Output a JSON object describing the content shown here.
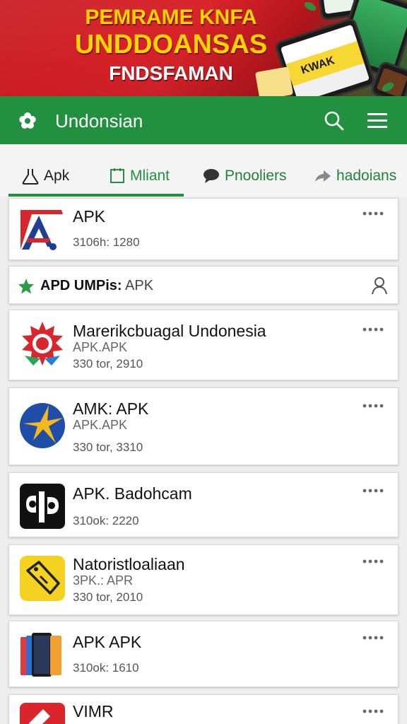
{
  "banner": {
    "line1": "PEMRAME KNFA",
    "line2": "UNDDOANSAS",
    "line3": "FNDSFAMAN",
    "phone_text": "KWAK"
  },
  "toolbar": {
    "title": "Undonsian",
    "logo_icon": "flower-icon",
    "search_icon": "search-icon",
    "menu_icon": "hamburger-menu-icon",
    "color": "#219140"
  },
  "tabs": [
    {
      "label": "Apk",
      "icon": "flask-icon",
      "active": true
    },
    {
      "label": "Mliant",
      "icon": "square-icon"
    },
    {
      "label": "Pnooliers",
      "icon": "chat-bubble-icon"
    },
    {
      "label": "hadoians",
      "icon": "share-arrow-icon"
    }
  ],
  "filter": {
    "label_bold": "APD UMPis:",
    "label_value": "APK",
    "star_icon": "star-icon",
    "person_icon": "person-icon"
  },
  "apps": [
    {
      "name": "APK",
      "sub": "",
      "meta": "3106h: 1280",
      "icon": "app-icon-red-blue-a"
    },
    {
      "name": "Marerikcbuagal Undonesia",
      "sub": "APK.APK",
      "meta": "330 tor, 2910",
      "icon": "app-icon-sun-emblem"
    },
    {
      "name": "AMK: APK",
      "sub": "APK.APK",
      "meta": "330 tor, 3310",
      "icon": "app-icon-blue-yellow-globe"
    },
    {
      "name": "APK. Badohcam",
      "sub": "",
      "meta": "310ok: 2220",
      "icon": "app-icon-black-logo"
    },
    {
      "name": "Natoristloaliaan",
      "sub": "3PK.: APR",
      "meta": "330 tor, 2010",
      "icon": "app-icon-yellow-tag"
    },
    {
      "name": "APK APK",
      "sub": "",
      "meta": "310ok: 1610",
      "icon": "app-icon-phones"
    },
    {
      "name": "VIMR",
      "sub": "",
      "meta": "",
      "icon": "app-icon-red-tool"
    }
  ]
}
